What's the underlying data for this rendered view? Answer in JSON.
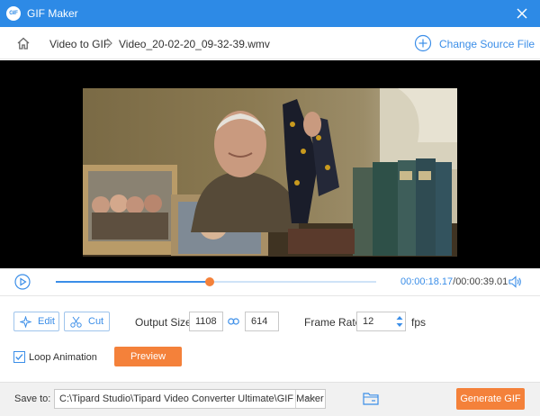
{
  "window": {
    "title": "GIF Maker",
    "app_icon_text": "GIF",
    "accent_color": "#2d8ae6",
    "action_color": "#f4813a"
  },
  "breadcrumb": {
    "home_icon": "home-icon",
    "section": "Video to GIF",
    "file": "Video_20-02-20_09-32-39.wmv"
  },
  "source": {
    "change_label": "Change Source File"
  },
  "player": {
    "current_time": "00:00:18.17",
    "separator": "/",
    "total_time": "00:00:39.01",
    "progress_fraction": 0.48
  },
  "toolbar": {
    "edit_label": "Edit",
    "cut_label": "Cut"
  },
  "output": {
    "size_label": "Output Size:",
    "width": "1108",
    "height": "614",
    "frame_rate_label": "Frame Rate:",
    "frame_rate": "12",
    "fps_unit": "fps"
  },
  "options": {
    "loop_label": "Loop Animation",
    "loop_checked": true,
    "preview_label": "Preview"
  },
  "footer": {
    "save_label": "Save to:",
    "path": "C:\\Tipard Studio\\Tipard Video Converter Ultimate\\GIF Maker",
    "more_label": "···",
    "generate_label": "Generate GIF"
  }
}
